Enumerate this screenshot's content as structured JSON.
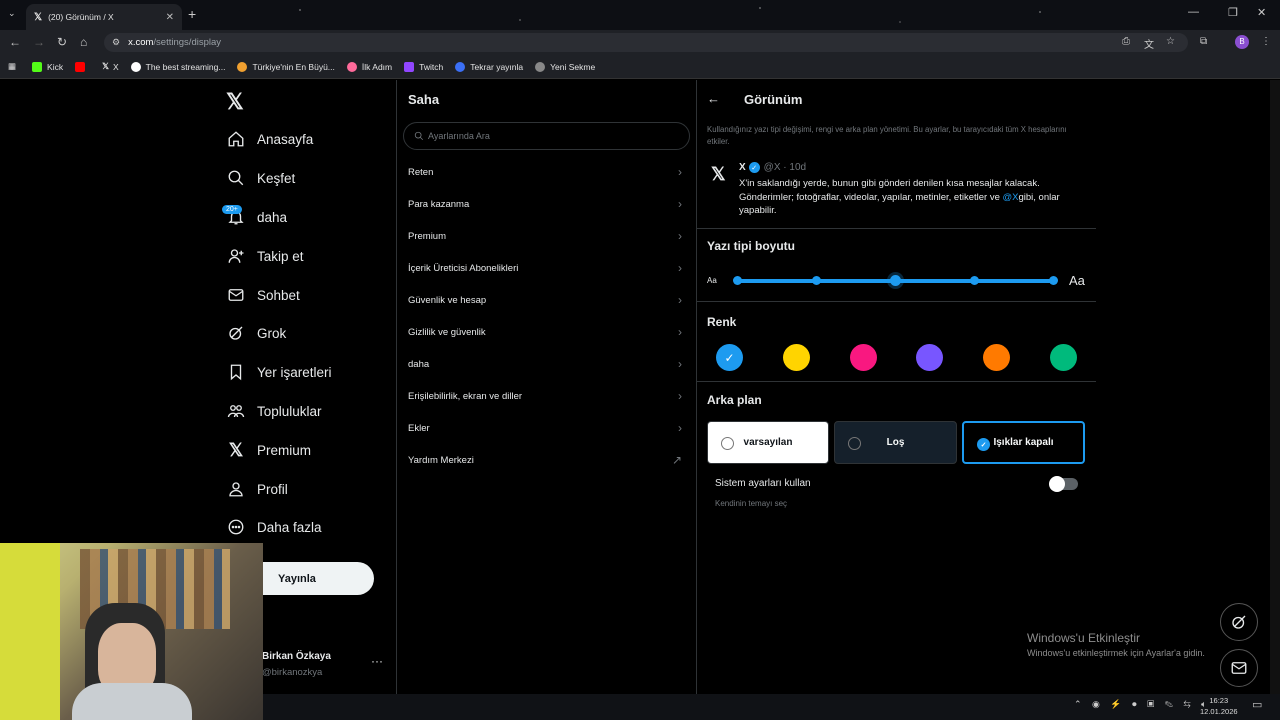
{
  "browser": {
    "tab_title": "(20) Görünüm / X",
    "url_host": "x.com",
    "url_path": "/settings/display",
    "profile_initial": "B",
    "bookmarks": [
      {
        "label": "Kick",
        "color": "#53fc18"
      },
      {
        "label": "",
        "color": "#ff0000"
      },
      {
        "label": "X",
        "color": "#000000"
      },
      {
        "label": "The best streaming...",
        "color": "#ffffff"
      },
      {
        "label": "Türkiye'nin En Büyü...",
        "color": "#f0a030"
      },
      {
        "label": "İlk Adım",
        "color": "#ff6a9a"
      },
      {
        "label": "Twitch",
        "color": "#9146ff"
      },
      {
        "label": "Tekrar yayınla",
        "color": "#3b6ff5"
      },
      {
        "label": "Yeni Sekme",
        "color": "#888888"
      }
    ]
  },
  "nav": {
    "badge": "20+",
    "items": [
      {
        "label": "Anasayfa",
        "icon": "home-icon"
      },
      {
        "label": "Keşfet",
        "icon": "search-icon"
      },
      {
        "label": "daha",
        "icon": "bell-icon"
      },
      {
        "label": "Takip et",
        "icon": "follow-icon"
      },
      {
        "label": "Sohbet",
        "icon": "mail-icon"
      },
      {
        "label": "Grok",
        "icon": "grok-icon"
      },
      {
        "label": "Yer işaretleri",
        "icon": "bookmark-icon"
      },
      {
        "label": "Topluluklar",
        "icon": "communities-icon"
      },
      {
        "label": "Premium",
        "icon": "x-premium-icon"
      },
      {
        "label": "Profil",
        "icon": "profile-icon"
      },
      {
        "label": "Daha fazla",
        "icon": "more-icon"
      }
    ],
    "post_button": "Yayınla",
    "user_name": "Birkan Özkaya",
    "user_handle": "@birkanozkya",
    "user_more": "···"
  },
  "middle": {
    "title": "Saha",
    "search_placeholder": "Ayarlarında Ara",
    "items": [
      {
        "label": "Reten",
        "arrow": "›"
      },
      {
        "label": "Para kazanma",
        "arrow": "›"
      },
      {
        "label": "Premium",
        "arrow": "›"
      },
      {
        "label": "İçerik Üreticisi Abonelikleri",
        "arrow": "›"
      },
      {
        "label": "Güvenlik ve hesap",
        "arrow": "›"
      },
      {
        "label": "Gizlilik ve güvenlik",
        "arrow": "›"
      },
      {
        "label": "daha",
        "arrow": "›"
      },
      {
        "label": "Erişilebilirlik, ekran ve diller",
        "arrow": "›"
      },
      {
        "label": "Ekler",
        "arrow": "›"
      },
      {
        "label": "Yardım Merkezi",
        "arrow": "↗"
      }
    ]
  },
  "display": {
    "title": "Görünüm",
    "description": "Kullandığınız yazı tipi değişimi, rengi ve arka plan yönetimi. Bu ayarlar, bu tarayıcıdaki tüm X hesaplarını etkiler.",
    "preview": {
      "name": "X",
      "meta": "@X · 10d",
      "text_before": "X'in saklandığı yerde, bunun gibi gönderi denilen kısa mesajlar kalacak. Gönderimler; fotoğraflar, videolar, yapılar, metinler, etiketler ve",
      "link": "@X",
      "text_after": "gibi, onlar yapabilir."
    },
    "font_size_title": "Yazı tipi boyutu",
    "font_small": "Aa",
    "font_large": "Aa",
    "font_size_level": 3,
    "font_size_steps": 5,
    "color_title": "Renk",
    "colors": [
      "#1d9bf0",
      "#ffd400",
      "#f91880",
      "#7856ff",
      "#ff7a00",
      "#00ba7c"
    ],
    "selected_color_index": 0,
    "background_title": "Arka plan",
    "bg_options": [
      {
        "label": "varsayılan",
        "bg": "#ffffff",
        "fg": "#0f1419"
      },
      {
        "label": "Loş",
        "bg": "#15202b",
        "fg": "#f7f9f9"
      },
      {
        "label": "Işıklar kapalı",
        "bg": "#000000",
        "fg": "#f7f9f9"
      }
    ],
    "selected_bg_index": 2,
    "system_label": "Sistem ayarları kullan",
    "system_sub": "Kendinin temayı seç"
  },
  "watermark": {
    "line1": "Windows'u Etkinleştir",
    "line2": "Windows'u etkinleştirmek için Ayarlar'a gidin."
  },
  "taskbar": {
    "time": "16:23",
    "date": "12.01.2026"
  }
}
